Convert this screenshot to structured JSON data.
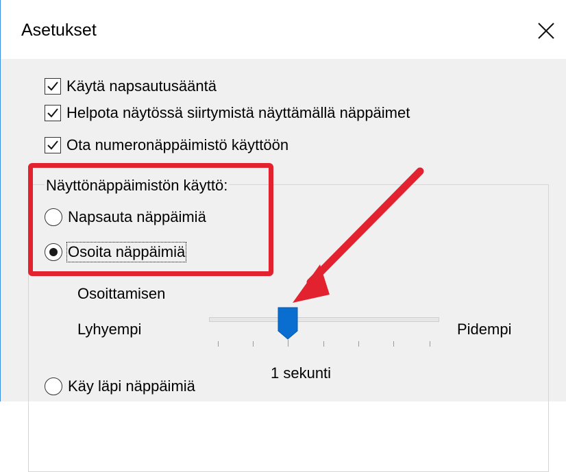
{
  "window": {
    "title": "Asetukset"
  },
  "checkboxes": [
    {
      "label": "Käytä napsautusääntä",
      "checked": true
    },
    {
      "label": "Helpota näytössä siirtymistä näyttämällä näppäimet",
      "checked": true
    },
    {
      "label": "Ota numeronäppäimistö käyttöön",
      "checked": true
    }
  ],
  "group": {
    "label": "Näyttönäppäimistön käyttö:",
    "options": [
      {
        "label": "Napsauta näppäimiä",
        "selected": false
      },
      {
        "label": "Osoita näppäimiä",
        "selected": true
      },
      {
        "label": "Käy läpi näppäimiä",
        "selected": false
      }
    ]
  },
  "hover_slider": {
    "heading": "Osoittamisen",
    "min_label": "Lyhyempi",
    "max_label": "Pidempi",
    "value_label": "1 sekunti"
  },
  "colors": {
    "highlight_red": "#e2222f",
    "thumb_blue": "#0a6ed1",
    "window_bg": "#f0f0f0"
  }
}
